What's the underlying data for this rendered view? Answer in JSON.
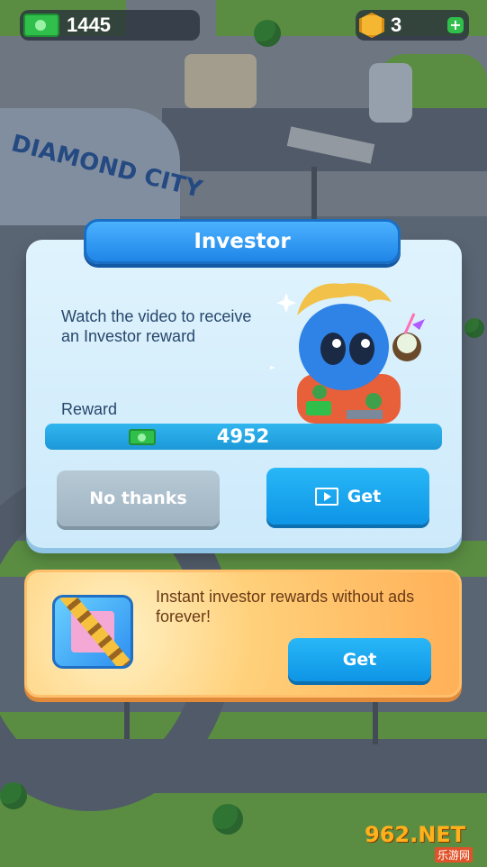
{
  "hud": {
    "cash": "1445",
    "gems": "3",
    "cash_icon": "cash-icon",
    "gem_icon": "coin-icon",
    "plus_icon": "plus-icon"
  },
  "investor_dialog": {
    "title": "Investor",
    "description": "Watch the video to receive an Investor reward",
    "reward_label": "Reward",
    "reward_value": "4952",
    "no_thanks_label": "No thanks",
    "get_label": "Get"
  },
  "promo": {
    "text": "Instant investor rewards without ads forever!",
    "get_label": "Get"
  },
  "city_sign": "DIAMOND CITY",
  "watermark": {
    "main": "962.NET",
    "sub": "乐游网"
  },
  "colors": {
    "title_blue": "#1f86e8",
    "get_blue": "#0e95e6",
    "no_thanks_gray": "#9fb3c1",
    "cash_green": "#2fbf4a",
    "promo_orange": "#ffb057"
  }
}
